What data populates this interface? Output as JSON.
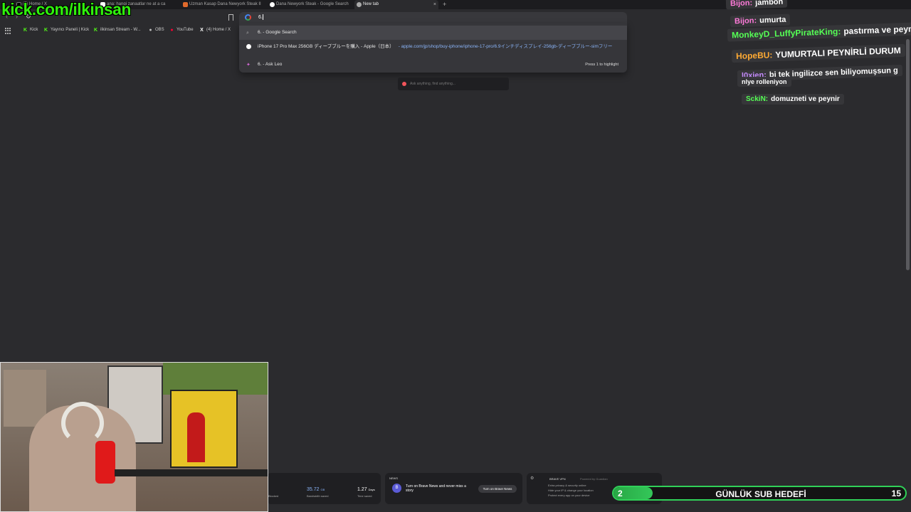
{
  "tabs": [
    {
      "label": "(5) Home / X",
      "active": false
    },
    {
      "label": "ana: hangi zanaatlar ne at a ca",
      "active": false
    },
    {
      "label": "Uzman Kasap Dana Newyork Steak II",
      "active": false
    },
    {
      "label": "Dana Newyork Steak - Google Search",
      "active": false
    },
    {
      "label": "New tab",
      "active": true
    }
  ],
  "tab_close": "×",
  "new_tab_symbol": "+",
  "omnibox": {
    "value": "6."
  },
  "bookmarks": [
    {
      "label": "Kick",
      "icon": "K",
      "color": "#53fc18"
    },
    {
      "label": "Yayıncı Paneli | Kick",
      "icon": "K",
      "color": "#53fc18"
    },
    {
      "label": "ilkinsan Stream - W...",
      "icon": "K",
      "color": "#53fc18"
    },
    {
      "label": "OBS",
      "icon": "●",
      "color": "#bbbbbb"
    },
    {
      "label": "YouTube",
      "icon": "●",
      "color": "#ff0000"
    },
    {
      "label": "(4) Home / X",
      "icon": "X",
      "color": "#ffffff"
    }
  ],
  "suggestions": [
    {
      "text": "6. - Google Search",
      "url": "",
      "right": ""
    },
    {
      "text": "iPhone 17 Pro Max 256GB ディープブルーを購入 - Apple（日本）",
      "url": "- apple.com/jp/shop/buy-iphone/iphone-17-pro/6.9インチディスプレイ-256gb-ディープブルー-simフリー",
      "right": ""
    },
    {
      "text": "6. - Ask Leo",
      "url": "",
      "right": "Press 1 to highlight"
    }
  ],
  "leo_placeholder": "Ask anything, find anything...",
  "overlay": {
    "brand": "kick.com/ilkinsan",
    "chat": [
      {
        "user": "Bijon:",
        "text": "jambon",
        "color": "#ff7ad9"
      },
      {
        "user": "Bijon:",
        "text": "umurta",
        "color": "#ff7ad9"
      },
      {
        "user": "MonkeyD_LuffyPirateKing:",
        "text": "pastırma ve peyn",
        "color": "#55ff55"
      },
      {
        "user": "HopeBU:",
        "text": "YUMURTALI PEYNİRLİ DURUM",
        "color": "#ffaa33"
      },
      {
        "user": "l0xien:",
        "text": "bi tek ingilizce sen biliyomuşsun g",
        "color": "#c58bff"
      },
      {
        "user": "",
        "text": "nlye rolleniyon",
        "color": "#ffffff"
      },
      {
        "user": "SckiN:",
        "text": "domuzneti ve peynir",
        "color": "#55ff55"
      }
    ]
  },
  "stats": [
    {
      "value": "35.72",
      "unit": "GB",
      "label": "Bandwidth saved"
    },
    {
      "value": "1.27",
      "unit": "Days",
      "label": "Time saved"
    }
  ],
  "stats_fragment": "Blocked",
  "news": {
    "title": "NEWS",
    "text": "Turn on Brave News and never miss a story",
    "button": "Turn on Brave News",
    "icon": "B"
  },
  "vpn": {
    "title": "BRAVE VPN",
    "powered": "Powered by Guardian",
    "lines": [
      "Extra privacy & security online",
      "Hide your IP & change your location",
      "Protect every app on your device"
    ]
  },
  "subgoal": {
    "title": "GÜNLÜK SUB HEDEFİ",
    "current": "2",
    "target": "15",
    "progress": 0.133
  }
}
